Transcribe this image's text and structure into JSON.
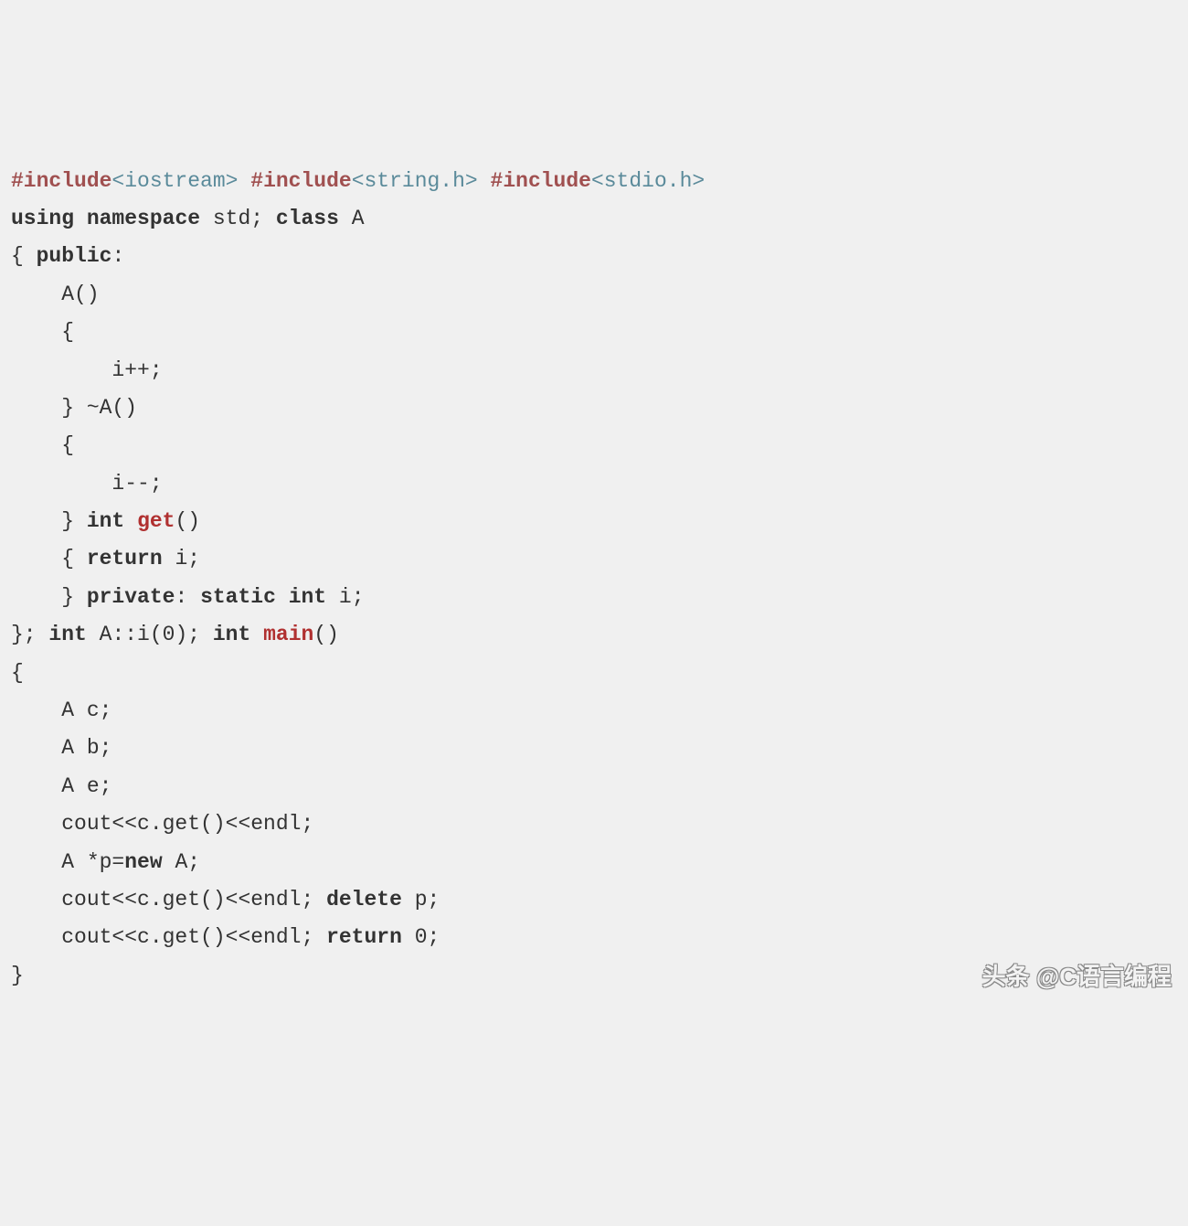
{
  "code": {
    "line1_inc1": "#include",
    "line1_ang1": "<iostream>",
    "line1_inc2": "#include",
    "line1_ang2": "<string.h>",
    "line1_inc3": "#include",
    "line1_ang3": "<stdio.h>",
    "line2_using": "using",
    "line2_ns": "namespace",
    "line2_std": "std; ",
    "line2_class": "class",
    "line2_A": " A",
    "line3": "{ ",
    "line3_public": "public",
    "line3_colon": ":",
    "line4": "    A()",
    "line5": "    {",
    "line6": "        i++;",
    "line7": "    } ~A()",
    "line8": "    {",
    "line9": "        i--;",
    "line10_a": "    } ",
    "line10_int": "int",
    "line10_sp": " ",
    "line10_get": "get",
    "line10_paren": "()",
    "line11_a": "    { ",
    "line11_return": "return",
    "line11_b": " i;",
    "line12_a": "    } ",
    "line12_private": "private",
    "line12_b": ": ",
    "line12_static": "static",
    "line12_c": " ",
    "line12_int": "int",
    "line12_d": " i;",
    "line13_a": "}; ",
    "line13_int1": "int",
    "line13_b": " A::i(0); ",
    "line13_int2": "int",
    "line13_c": " ",
    "line13_main": "main",
    "line13_d": "()",
    "line14": "{",
    "line15": "    A c;",
    "line16": "    A b;",
    "line17": "    A e;",
    "line18": "    cout<<c.get()<<endl;",
    "line19_a": "    A *p=",
    "line19_new": "new",
    "line19_b": " A;",
    "line20_a": "    cout<<c.get()<<endl; ",
    "line20_delete": "delete",
    "line20_b": " p;",
    "line21_a": "    cout<<c.get()<<endl; ",
    "line21_return": "return",
    "line21_b": " 0;",
    "line22": "}"
  },
  "watermark": "头条 @C语言编程"
}
